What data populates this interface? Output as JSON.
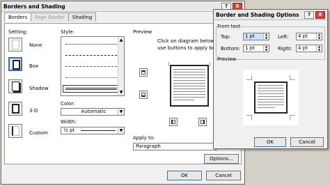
{
  "main": {
    "title": "Borders and Shading",
    "tabs": [
      "Borders",
      "Page Border",
      "Shading"
    ],
    "setting_label": "Setting:",
    "settings": [
      "None",
      "Box",
      "Shadow",
      "3-D",
      "Custom"
    ],
    "style_label": "Style:",
    "color_label": "Color:",
    "color_value": "Automatic",
    "width_label": "Width:",
    "width_value": "½ pt",
    "preview_label": "Preview",
    "preview_hint_1": "Click on diagram below o",
    "preview_hint_2": "use buttons to apply bord",
    "apply_label": "Apply to:",
    "apply_value": "Paragraph",
    "options_button": "Options...",
    "ok_button": "OK",
    "cancel_button": "Cancel"
  },
  "options": {
    "title": "Border and Shading Options",
    "from_text_label": "From text",
    "top_label": "Top:",
    "top_value": "1 pt",
    "bottom_label": "Bottom:",
    "bottom_value": "1 pt",
    "left_label": "Left:",
    "left_value": "4 pt",
    "right_label": "Right:",
    "right_value": "4 pt",
    "preview_label": "Preview",
    "ok_button": "OK",
    "cancel_button": "Cancel"
  },
  "titlebar": {
    "help": "?",
    "close": "X"
  }
}
